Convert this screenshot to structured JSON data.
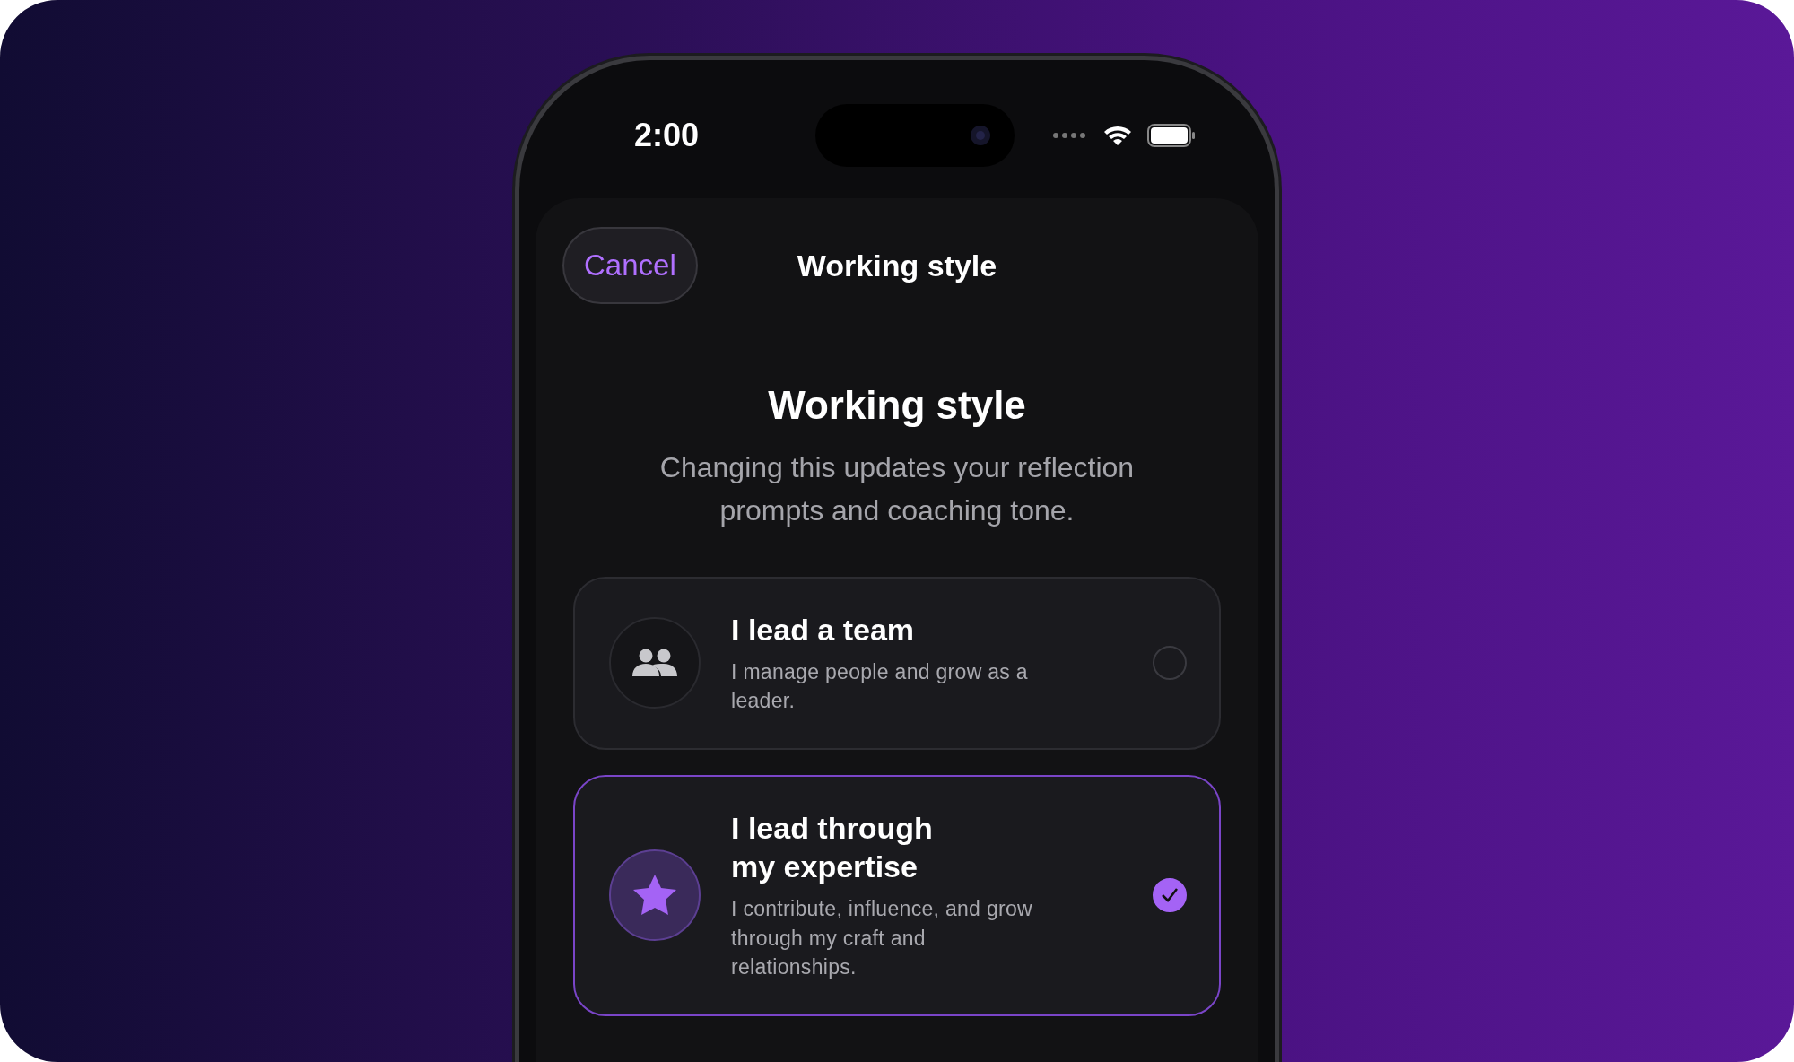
{
  "status_bar": {
    "time": "2:00"
  },
  "nav": {
    "cancel": "Cancel",
    "title": "Working style"
  },
  "header": {
    "title": "Working style",
    "subtitle": "Changing this updates your reflection prompts and coaching tone."
  },
  "options": [
    {
      "kind": "team",
      "title": "I lead a team",
      "description": "I manage people and grow as a leader.",
      "selected": false
    },
    {
      "kind": "expertise",
      "title": "I lead through my expertise",
      "description": "I contribute, influence, and grow through my craft and relationships.",
      "selected": true
    }
  ]
}
